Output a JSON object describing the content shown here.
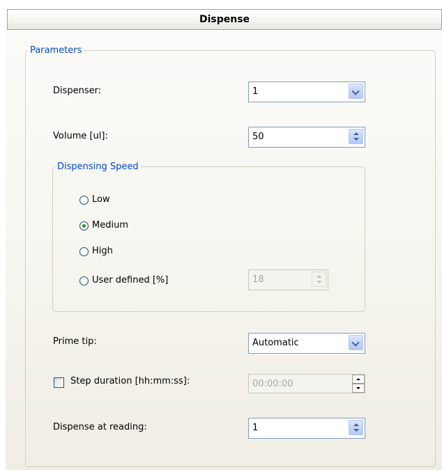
{
  "title": "Dispense",
  "parameters_legend": "Parameters",
  "dispenser": {
    "label": "Dispenser:",
    "value": "1"
  },
  "volume": {
    "label": "Volume [ul]:",
    "value": "50"
  },
  "speed": {
    "legend": "Dispensing Speed",
    "options": [
      {
        "label": "Low",
        "checked": false
      },
      {
        "label": "Medium",
        "checked": true
      },
      {
        "label": "High",
        "checked": false
      },
      {
        "label": "User defined [%]",
        "checked": false
      }
    ],
    "user_defined_value": "18"
  },
  "prime_tip": {
    "label": "Prime tip:",
    "value": "Automatic"
  },
  "step_duration": {
    "label": "Step duration [hh:mm:ss]:",
    "checked": false,
    "value": "00:00:00"
  },
  "dispense_at_reading": {
    "label": "Dispense at reading:",
    "value": "1"
  },
  "colors": {
    "legend_text": "#0046d5",
    "radio_dot": "#21a121",
    "input_border": "#7f9db9"
  }
}
